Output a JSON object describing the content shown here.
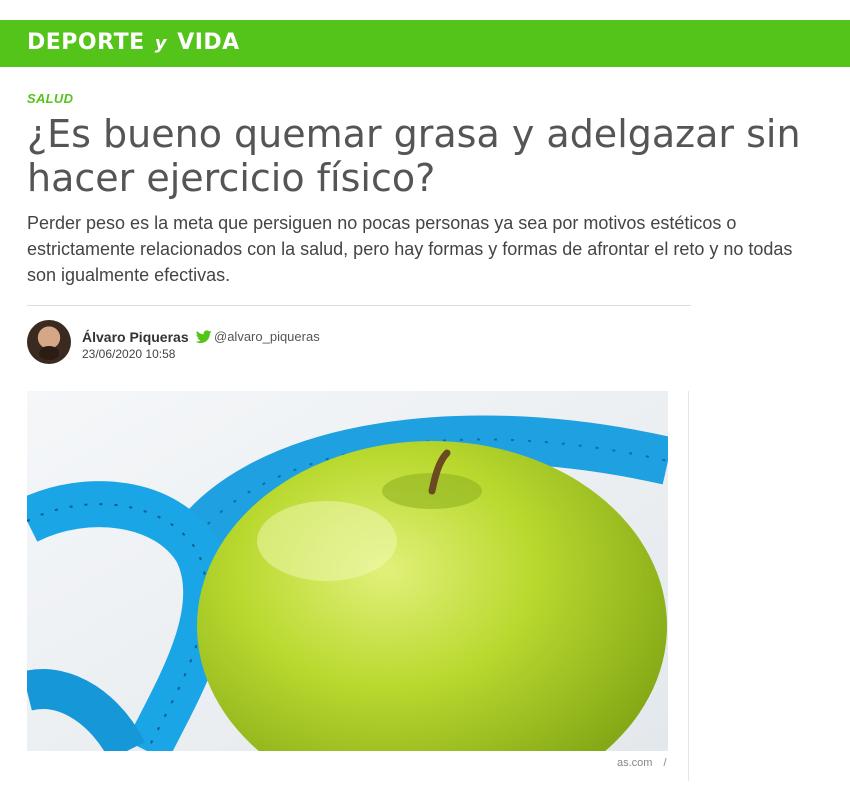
{
  "header": {
    "brand_word1": "DEPORTE",
    "brand_conj": "y",
    "brand_word2": "VIDA",
    "bar_color": "#55c41a"
  },
  "article": {
    "section": "SALUD",
    "title": "¿Es bueno quemar grasa y adelgazar sin hacer ejercicio físico?",
    "subtitle": "Perder peso es la meta que persiguen no pocas personas ya sea por motivos estéticos o estrictamente relacionados con la salud, pero hay formas y formas de afrontar el reto y no todas son igualmente efectivas."
  },
  "author": {
    "name": "Álvaro Piqueras",
    "twitter_icon": "twitter-icon",
    "twitter_handle": "@alvaro_piqueras",
    "date": "23/06/2020 10:58"
  },
  "image": {
    "credit": "as.com",
    "credit_separator": "/"
  }
}
